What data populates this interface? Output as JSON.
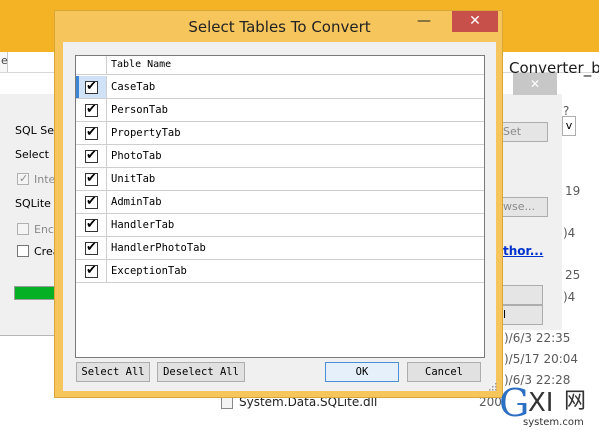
{
  "background_explorer": {
    "window_title_partial": "Converter_b",
    "left_tab_partial": "e",
    "file_items_partial": [
      "?",
      "19",
      ")4",
      "25",
      ")4",
      ")/6/3 22:35",
      ")/5/17 20:04",
      ")/6/3 22:28"
    ],
    "selected_file": {
      "name": "System.Data.SQLite.dll",
      "size_partial": "200"
    }
  },
  "background_converter": {
    "close_symbol": "✕",
    "labels": [
      "SQL Ser",
      "Select",
      "Inte",
      "SQLite",
      "Encr",
      "Crea"
    ],
    "buttons_partial": [
      "Set",
      "wse...",
      "l"
    ],
    "link_partial": "thor...",
    "partial_button_glyph": "v",
    "progress_fraction": 1.0,
    "progress_color": "#06b025"
  },
  "dialog": {
    "title": "Select Tables To Convert",
    "minimize_symbol": "—",
    "close_symbol": "✕",
    "column_header": "Table Name",
    "tables": [
      {
        "name": "CaseTab",
        "checked": true,
        "active": true
      },
      {
        "name": "PersonTab",
        "checked": true
      },
      {
        "name": "PropertyTab",
        "checked": true
      },
      {
        "name": "PhotoTab",
        "checked": true
      },
      {
        "name": "UnitTab",
        "checked": true
      },
      {
        "name": "AdminTab",
        "checked": true
      },
      {
        "name": "HandlerTab",
        "checked": true
      },
      {
        "name": "HandlerPhotoTab",
        "checked": true
      },
      {
        "name": "ExceptionTab",
        "checked": true
      }
    ],
    "buttons": {
      "select_all": "Select All",
      "deselect_all": "Deselect All",
      "ok": "OK",
      "cancel": "Cancel"
    }
  },
  "watermark": {
    "g": "G",
    "xi": "XI",
    "han": "网",
    "url": "system.com"
  },
  "colors": {
    "accent_titlebar": "#f3b325",
    "dialog_frame": "#f6c65d",
    "close_red": "#c7504a",
    "selection": "#cfe2f7"
  }
}
